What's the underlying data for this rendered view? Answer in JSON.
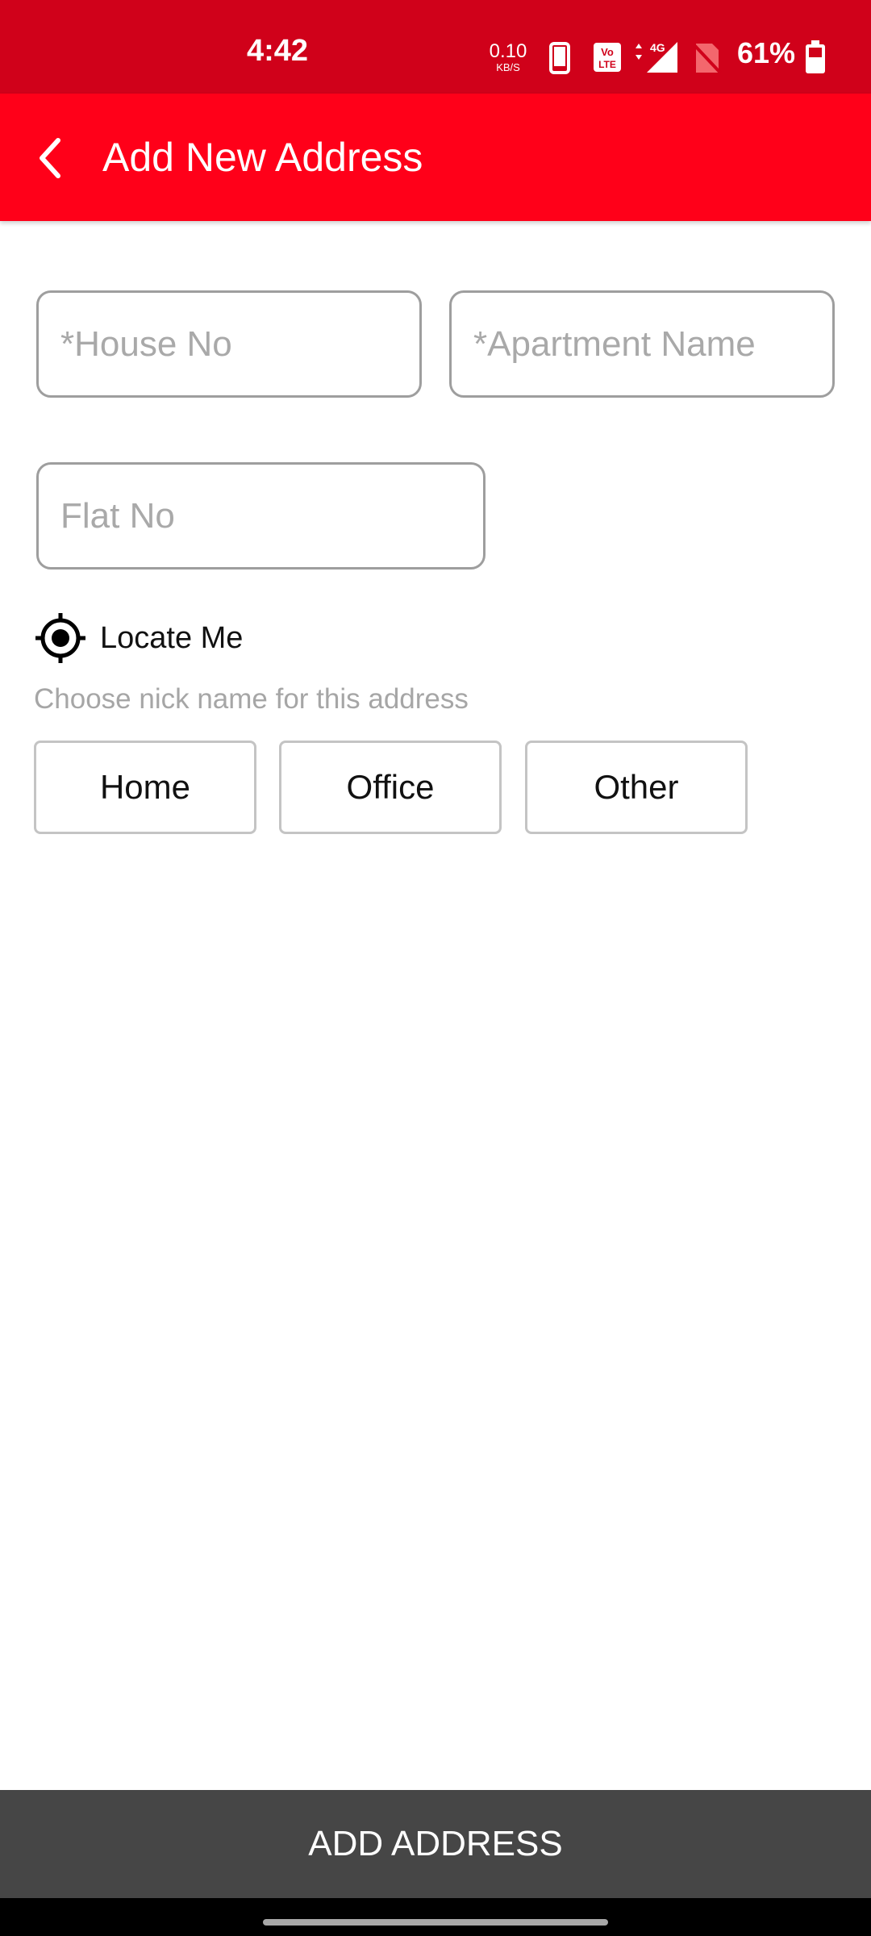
{
  "status_bar": {
    "time": "4:42",
    "network_speed_value": "0.10",
    "network_speed_unit": "KB/S",
    "signal_label": "4G",
    "volte_label_top": "Vo",
    "volte_label_bottom": "LTE",
    "battery_percent": "61%",
    "icons": [
      "phone-icon",
      "volte-icon",
      "signal-4g-icon",
      "no-sim-icon",
      "battery-icon"
    ],
    "background_color": "#d0011a"
  },
  "app_bar": {
    "title": "Add New Address",
    "back_icon": "chevron-left-icon",
    "background_color": "#ff0019"
  },
  "form": {
    "house_no": {
      "value": "",
      "placeholder": "*House No"
    },
    "apartment_name": {
      "value": "",
      "placeholder": "*Apartment Name"
    },
    "flat_no": {
      "value": "",
      "placeholder": "Flat No"
    }
  },
  "locate": {
    "label": "Locate Me",
    "icon": "crosshair-icon"
  },
  "nickname": {
    "hint": "Choose nick name for this address",
    "options": [
      "Home",
      "Office",
      "Other"
    ]
  },
  "footer": {
    "add_address_label": "ADD ADDRESS",
    "background_color": "#464646"
  }
}
